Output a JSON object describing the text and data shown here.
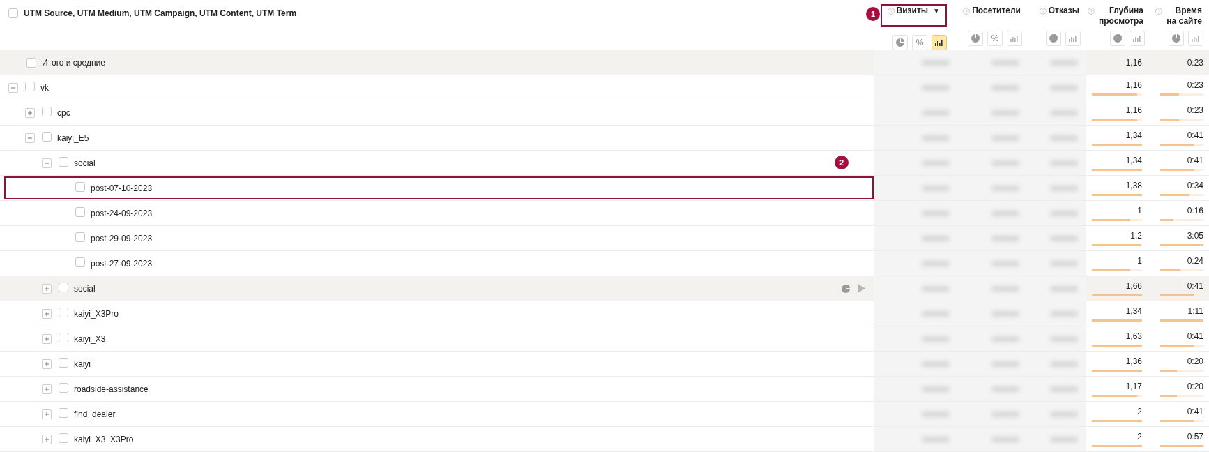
{
  "header": {
    "checked": false,
    "title": "UTM Source, UTM Medium, UTM Campaign, UTM Content, UTM Term",
    "badge": "1"
  },
  "columns": [
    {
      "label": "Визиты",
      "sort": "▼",
      "outlined": true,
      "buttons": [
        {
          "kind": "pie",
          "selected": false
        },
        {
          "kind": "percent",
          "text": "%",
          "selected": false
        },
        {
          "kind": "bars",
          "selected": true
        }
      ]
    },
    {
      "label": "Посетители",
      "outlined": false,
      "buttons": [
        {
          "kind": "pie",
          "selected": false
        },
        {
          "kind": "percent",
          "text": "%",
          "selected": false
        },
        {
          "kind": "bars",
          "selected": false
        }
      ]
    },
    {
      "label": "Отказы",
      "outlined": false,
      "buttons": [
        {
          "kind": "pie",
          "selected": false
        },
        {
          "kind": "bars",
          "selected": false
        }
      ]
    },
    {
      "label": "Глубина просмотра",
      "outlined": false,
      "buttons": [
        {
          "kind": "pie",
          "selected": false
        },
        {
          "kind": "bars",
          "selected": false
        }
      ]
    },
    {
      "label": "Время на сайте",
      "outlined": false,
      "buttons": [
        {
          "kind": "pie",
          "selected": false
        },
        {
          "kind": "bars",
          "selected": false
        }
      ]
    }
  ],
  "total": {
    "label": "Итого и средние",
    "checked": false,
    "metrics": [
      {
        "value": "1,16"
      },
      {
        "value": "0:23"
      }
    ]
  },
  "rows": [
    {
      "label": "vk",
      "checked": false,
      "expanded": true,
      "metrics": [
        {
          "value": "1,16",
          "level": 0.9
        },
        {
          "value": "0:23",
          "level": 0.44
        }
      ],
      "children": [
        {
          "label": "cpc",
          "checked": false,
          "expanded": false,
          "metrics": [
            {
              "value": "1,16",
              "level": 0.9
            },
            {
              "value": "0:23",
              "level": 0.43
            }
          ]
        },
        {
          "label": "kaiyi_E5",
          "checked": false,
          "expanded": true,
          "metrics": [
            {
              "value": "1,34",
              "level": 1
            },
            {
              "value": "0:41",
              "level": 0.78
            }
          ],
          "children": [
            {
              "label": "social",
              "checked": false,
              "expanded": true,
              "badge": "2",
              "metrics": [
                {
                  "value": "1,34",
                  "level": 1
                },
                {
                  "value": "0:41",
                  "level": 0.78
                }
              ],
              "children": [
                {
                  "label": "post-07-10-2023",
                  "checked": false,
                  "outlined": true,
                  "metrics": [
                    {
                      "value": "1,38",
                      "level": 1
                    },
                    {
                      "value": "0:34",
                      "level": 0.67
                    }
                  ]
                },
                {
                  "label": "post-24-09-2023",
                  "checked": false,
                  "metrics": [
                    {
                      "value": "1",
                      "level": 0.77
                    },
                    {
                      "value": "0:16",
                      "level": 0.3
                    }
                  ]
                },
                {
                  "label": "post-29-09-2023",
                  "checked": false,
                  "metrics": [
                    {
                      "value": "1,2",
                      "level": 0.97
                    },
                    {
                      "value": "3:05",
                      "level": 1
                    }
                  ]
                },
                {
                  "label": "post-27-09-2023",
                  "checked": false,
                  "metrics": [
                    {
                      "value": "1",
                      "level": 0.77
                    },
                    {
                      "value": "0:24",
                      "level": 0.46
                    }
                  ]
                }
              ]
            },
            {
              "label": "social",
              "checked": false,
              "expanded": false,
              "hovered": true,
              "metrics": [
                {
                  "value": "1,66",
                  "level": 1
                },
                {
                  "value": "0:41",
                  "level": 0.78
                }
              ]
            },
            {
              "label": "kaiyi_X3Pro",
              "checked": false,
              "expanded": false,
              "metrics": [
                {
                  "value": "1,34",
                  "level": 1
                },
                {
                  "value": "1:11",
                  "level": 1
                }
              ]
            },
            {
              "label": "kaiyi_X3",
              "checked": false,
              "expanded": false,
              "metrics": [
                {
                  "value": "1,63",
                  "level": 1
                },
                {
                  "value": "0:41",
                  "level": 0.78
                }
              ]
            },
            {
              "label": "kaiyi",
              "checked": false,
              "expanded": false,
              "metrics": [
                {
                  "value": "1,36",
                  "level": 1
                },
                {
                  "value": "0:20",
                  "level": 0.38
                }
              ]
            },
            {
              "label": "roadside-assistance",
              "checked": false,
              "expanded": false,
              "metrics": [
                {
                  "value": "1,17",
                  "level": 0.9
                },
                {
                  "value": "0:20",
                  "level": 0.38
                }
              ]
            },
            {
              "label": "find_dealer",
              "checked": false,
              "expanded": false,
              "metrics": [
                {
                  "value": "2",
                  "level": 1
                },
                {
                  "value": "0:41",
                  "level": 0.78
                }
              ]
            },
            {
              "label": "kaiyi_X3_X3Pro",
              "checked": false,
              "expanded": false,
              "metrics": [
                {
                  "value": "2",
                  "level": 1
                },
                {
                  "value": "0:57",
                  "level": 1
                }
              ]
            }
          ]
        }
      ]
    }
  ]
}
